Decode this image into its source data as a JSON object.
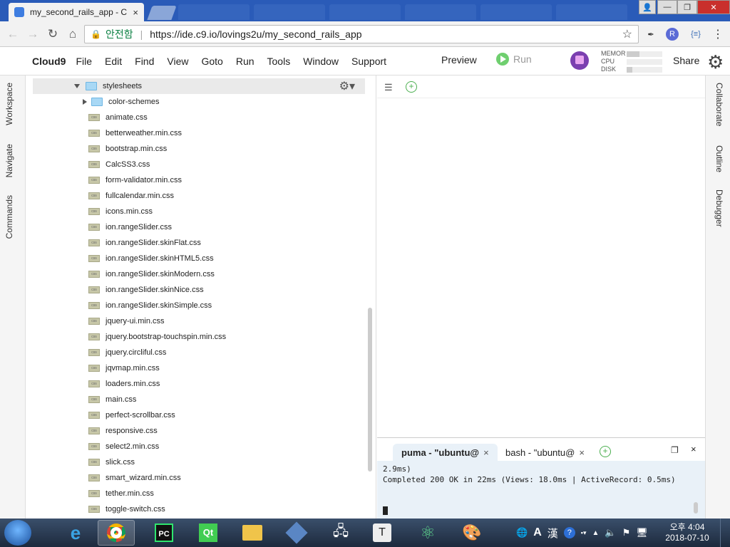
{
  "browser": {
    "tab_title": "my_second_rails_app - C",
    "tab_close": "×",
    "secure_label": "안전함",
    "url": "https://ide.c9.io/lovings2u/my_second_rails_app",
    "ext_r": "R",
    "ext_braces": "{≡}"
  },
  "c9": {
    "brand": "Cloud9",
    "menus": [
      "File",
      "Edit",
      "Find",
      "View",
      "Goto",
      "Run",
      "Tools",
      "Window",
      "Support"
    ],
    "preview": "Preview",
    "run": "Run",
    "metrics": [
      {
        "label": "MEMOR",
        "level": 0.35
      },
      {
        "label": "CPU",
        "level": 0.0
      },
      {
        "label": "DISK",
        "level": 0.15
      }
    ],
    "share": "Share"
  },
  "left_tabs": [
    "Workspace",
    "Navigate",
    "Commands"
  ],
  "right_tabs": [
    "Collaborate",
    "Outline",
    "Debugger"
  ],
  "tree": {
    "root": "stylesheets",
    "folder": "color-schemes",
    "css_icon": "css",
    "files": [
      "animate.css",
      "betterweather.min.css",
      "bootstrap.min.css",
      "CalcSS3.css",
      "form-validator.min.css",
      "fullcalendar.min.css",
      "icons.min.css",
      "ion.rangeSlider.css",
      "ion.rangeSlider.skinFlat.css",
      "ion.rangeSlider.skinHTML5.css",
      "ion.rangeSlider.skinModern.css",
      "ion.rangeSlider.skinNice.css",
      "ion.rangeSlider.skinSimple.css",
      "jquery-ui.min.css",
      "jquery.bootstrap-touchspin.min.css",
      "jquery.circliful.css",
      "jqvmap.min.css",
      "loaders.min.css",
      "main.css",
      "perfect-scrollbar.css",
      "responsive.css",
      "select2.min.css",
      "slick.css",
      "smart_wizard.min.css",
      "tether.min.css",
      "toggle-switch.css"
    ]
  },
  "terminal": {
    "tabs": [
      {
        "label": "puma - \"ubuntu@",
        "close": "×"
      },
      {
        "label": "bash - \"ubuntu@",
        "close": "×"
      }
    ],
    "close": "×",
    "lines": [
      "2.9ms)",
      "Completed 200 OK in 22ms (Views: 18.0ms | ActiveRecord: 0.5ms)"
    ]
  },
  "taskbar": {
    "tray_ime_a": "A",
    "tray_ime_han": "漢",
    "clock_time": "오후 4:04",
    "clock_date": "2018-07-10"
  }
}
